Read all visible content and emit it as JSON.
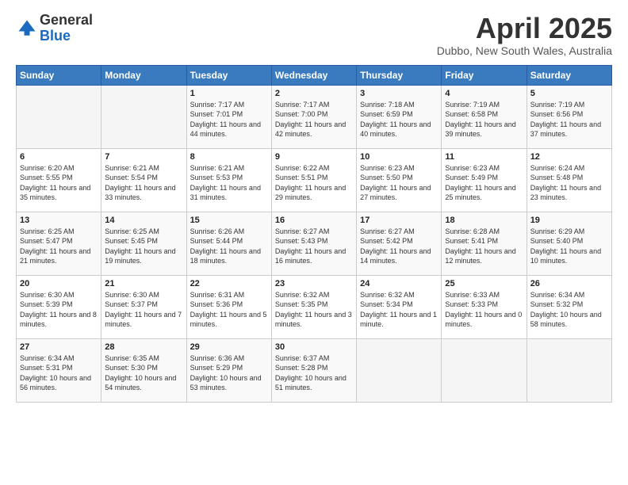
{
  "header": {
    "logo_general": "General",
    "logo_blue": "Blue",
    "month": "April 2025",
    "location": "Dubbo, New South Wales, Australia"
  },
  "days_of_week": [
    "Sunday",
    "Monday",
    "Tuesday",
    "Wednesday",
    "Thursday",
    "Friday",
    "Saturday"
  ],
  "weeks": [
    [
      {
        "day": "",
        "detail": ""
      },
      {
        "day": "",
        "detail": ""
      },
      {
        "day": "1",
        "detail": "Sunrise: 7:17 AM\nSunset: 7:01 PM\nDaylight: 11 hours and 44 minutes."
      },
      {
        "day": "2",
        "detail": "Sunrise: 7:17 AM\nSunset: 7:00 PM\nDaylight: 11 hours and 42 minutes."
      },
      {
        "day": "3",
        "detail": "Sunrise: 7:18 AM\nSunset: 6:59 PM\nDaylight: 11 hours and 40 minutes."
      },
      {
        "day": "4",
        "detail": "Sunrise: 7:19 AM\nSunset: 6:58 PM\nDaylight: 11 hours and 39 minutes."
      },
      {
        "day": "5",
        "detail": "Sunrise: 7:19 AM\nSunset: 6:56 PM\nDaylight: 11 hours and 37 minutes."
      }
    ],
    [
      {
        "day": "6",
        "detail": "Sunrise: 6:20 AM\nSunset: 5:55 PM\nDaylight: 11 hours and 35 minutes."
      },
      {
        "day": "7",
        "detail": "Sunrise: 6:21 AM\nSunset: 5:54 PM\nDaylight: 11 hours and 33 minutes."
      },
      {
        "day": "8",
        "detail": "Sunrise: 6:21 AM\nSunset: 5:53 PM\nDaylight: 11 hours and 31 minutes."
      },
      {
        "day": "9",
        "detail": "Sunrise: 6:22 AM\nSunset: 5:51 PM\nDaylight: 11 hours and 29 minutes."
      },
      {
        "day": "10",
        "detail": "Sunrise: 6:23 AM\nSunset: 5:50 PM\nDaylight: 11 hours and 27 minutes."
      },
      {
        "day": "11",
        "detail": "Sunrise: 6:23 AM\nSunset: 5:49 PM\nDaylight: 11 hours and 25 minutes."
      },
      {
        "day": "12",
        "detail": "Sunrise: 6:24 AM\nSunset: 5:48 PM\nDaylight: 11 hours and 23 minutes."
      }
    ],
    [
      {
        "day": "13",
        "detail": "Sunrise: 6:25 AM\nSunset: 5:47 PM\nDaylight: 11 hours and 21 minutes."
      },
      {
        "day": "14",
        "detail": "Sunrise: 6:25 AM\nSunset: 5:45 PM\nDaylight: 11 hours and 19 minutes."
      },
      {
        "day": "15",
        "detail": "Sunrise: 6:26 AM\nSunset: 5:44 PM\nDaylight: 11 hours and 18 minutes."
      },
      {
        "day": "16",
        "detail": "Sunrise: 6:27 AM\nSunset: 5:43 PM\nDaylight: 11 hours and 16 minutes."
      },
      {
        "day": "17",
        "detail": "Sunrise: 6:27 AM\nSunset: 5:42 PM\nDaylight: 11 hours and 14 minutes."
      },
      {
        "day": "18",
        "detail": "Sunrise: 6:28 AM\nSunset: 5:41 PM\nDaylight: 11 hours and 12 minutes."
      },
      {
        "day": "19",
        "detail": "Sunrise: 6:29 AM\nSunset: 5:40 PM\nDaylight: 11 hours and 10 minutes."
      }
    ],
    [
      {
        "day": "20",
        "detail": "Sunrise: 6:30 AM\nSunset: 5:39 PM\nDaylight: 11 hours and 8 minutes."
      },
      {
        "day": "21",
        "detail": "Sunrise: 6:30 AM\nSunset: 5:37 PM\nDaylight: 11 hours and 7 minutes."
      },
      {
        "day": "22",
        "detail": "Sunrise: 6:31 AM\nSunset: 5:36 PM\nDaylight: 11 hours and 5 minutes."
      },
      {
        "day": "23",
        "detail": "Sunrise: 6:32 AM\nSunset: 5:35 PM\nDaylight: 11 hours and 3 minutes."
      },
      {
        "day": "24",
        "detail": "Sunrise: 6:32 AM\nSunset: 5:34 PM\nDaylight: 11 hours and 1 minute."
      },
      {
        "day": "25",
        "detail": "Sunrise: 6:33 AM\nSunset: 5:33 PM\nDaylight: 11 hours and 0 minutes."
      },
      {
        "day": "26",
        "detail": "Sunrise: 6:34 AM\nSunset: 5:32 PM\nDaylight: 10 hours and 58 minutes."
      }
    ],
    [
      {
        "day": "27",
        "detail": "Sunrise: 6:34 AM\nSunset: 5:31 PM\nDaylight: 10 hours and 56 minutes."
      },
      {
        "day": "28",
        "detail": "Sunrise: 6:35 AM\nSunset: 5:30 PM\nDaylight: 10 hours and 54 minutes."
      },
      {
        "day": "29",
        "detail": "Sunrise: 6:36 AM\nSunset: 5:29 PM\nDaylight: 10 hours and 53 minutes."
      },
      {
        "day": "30",
        "detail": "Sunrise: 6:37 AM\nSunset: 5:28 PM\nDaylight: 10 hours and 51 minutes."
      },
      {
        "day": "",
        "detail": ""
      },
      {
        "day": "",
        "detail": ""
      },
      {
        "day": "",
        "detail": ""
      }
    ]
  ]
}
